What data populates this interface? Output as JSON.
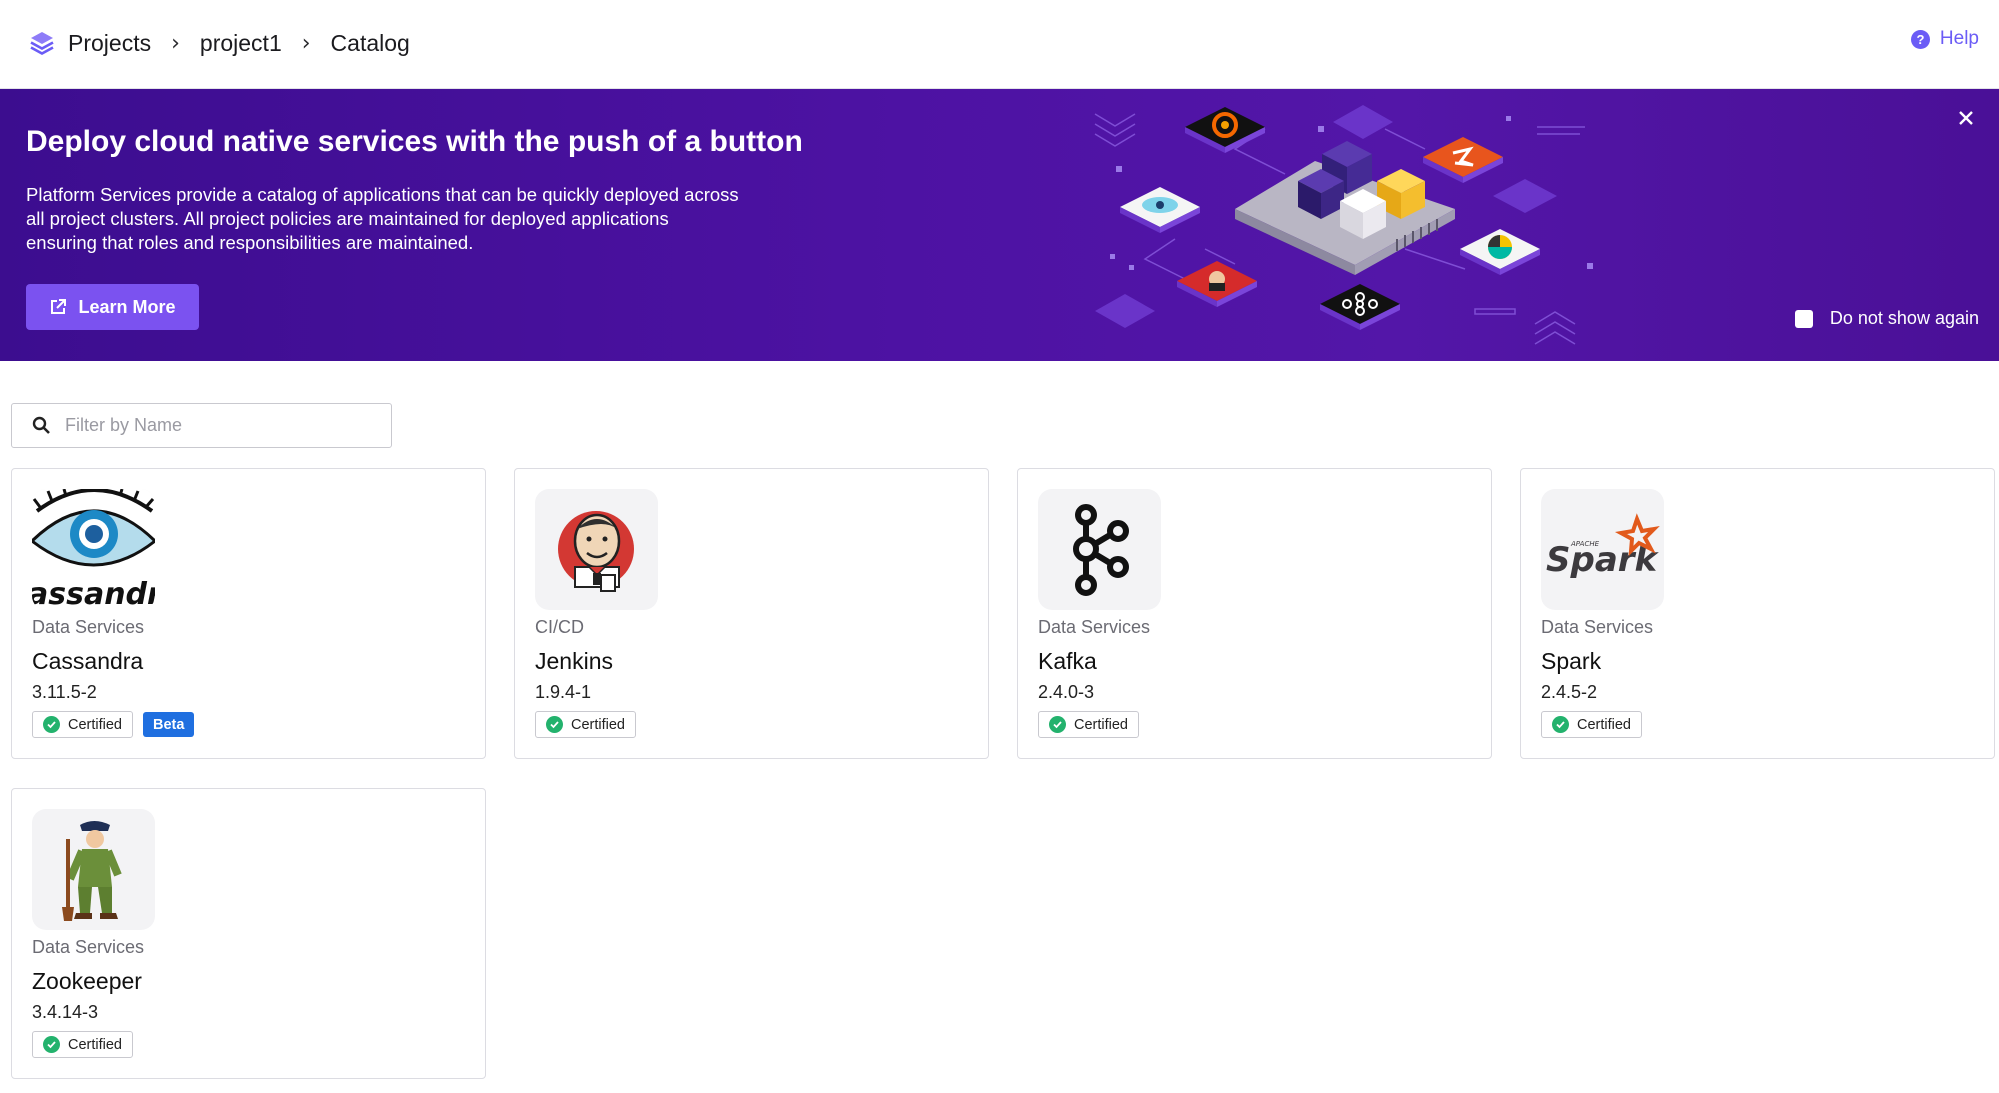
{
  "header": {
    "breadcrumb": [
      "Projects",
      "project1",
      "Catalog"
    ],
    "help_label": "Help"
  },
  "banner": {
    "title": "Deploy cloud native services with the push of a button",
    "text_lines": [
      "Platform Services provide a catalog of applications that can be quickly deployed across",
      "all project clusters. All project policies are maintained for deployed applications",
      "ensuring that roles and responsibilities are maintained."
    ],
    "learn_more_label": "Learn More",
    "do_not_show_label": "Do not show again",
    "do_not_show_checked": false,
    "colors": {
      "background": "#4d12a3",
      "button": "#7b52f0"
    }
  },
  "filter": {
    "placeholder": "Filter by Name",
    "value": ""
  },
  "certified_label": "Certified",
  "beta_label": "Beta",
  "cards": [
    {
      "category": "Data Services",
      "name": "Cassandra",
      "version": "3.11.5-2",
      "certified": true,
      "beta": true,
      "icon": "cassandra-logo-icon"
    },
    {
      "category": "CI/CD",
      "name": "Jenkins",
      "version": "1.9.4-1",
      "certified": true,
      "beta": false,
      "icon": "jenkins-logo-icon"
    },
    {
      "category": "Data Services",
      "name": "Kafka",
      "version": "2.4.0-3",
      "certified": true,
      "beta": false,
      "icon": "kafka-logo-icon"
    },
    {
      "category": "Data Services",
      "name": "Spark",
      "version": "2.4.5-2",
      "certified": true,
      "beta": false,
      "icon": "spark-logo-icon"
    },
    {
      "category": "Data Services",
      "name": "Zookeeper",
      "version": "3.4.14-3",
      "certified": true,
      "beta": false,
      "icon": "zookeeper-logo-icon"
    }
  ],
  "spark_logo_text": {
    "small": "APACHE",
    "main": "Spark"
  },
  "cassandra_logo_text": "assandr",
  "colors": {
    "accent": "#6b5cf6",
    "certified": "#23b26d",
    "beta": "#1f6fe0"
  }
}
